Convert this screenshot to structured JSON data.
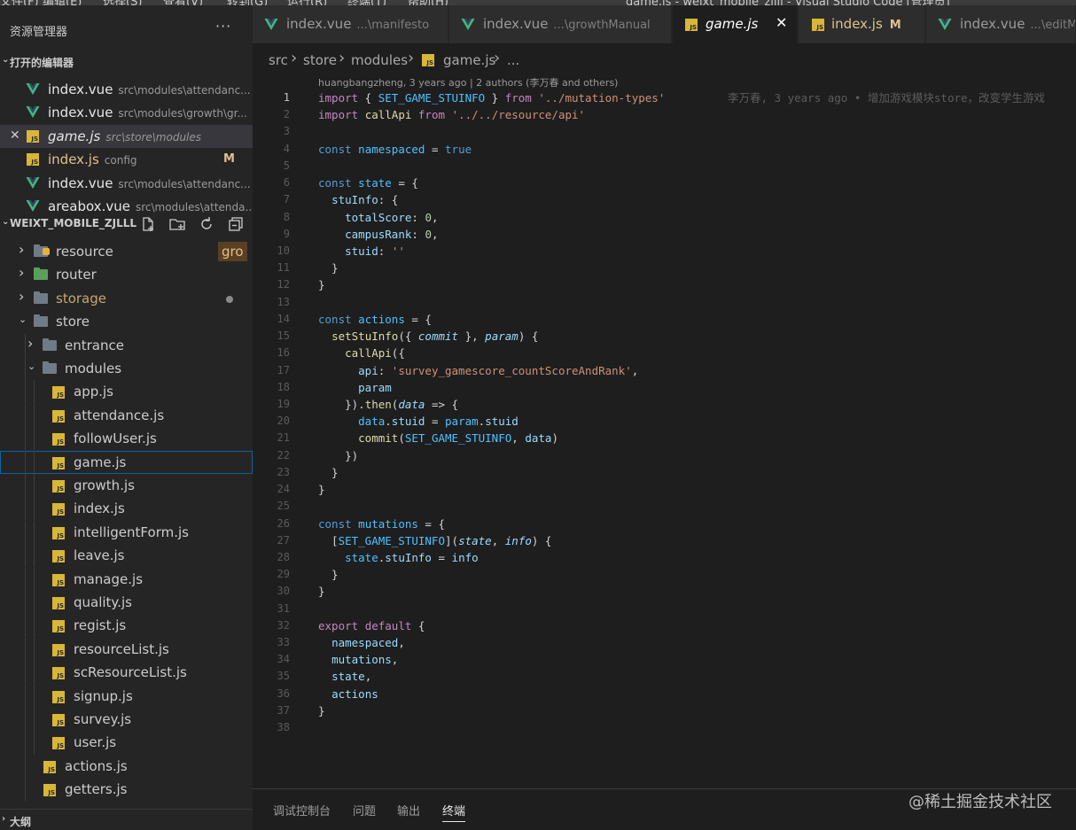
{
  "menubar": {
    "items": [
      "文件(F)",
      "编辑(E)",
      "选择(S)",
      "查看(V)",
      "转到(G)",
      "运行(R)",
      "终端(T)",
      "帮助(H)"
    ],
    "window_title": "game.js - weixt_mobile_zjlll - Visual Studio Code [管理员]"
  },
  "sidebar": {
    "title": "资源管理器",
    "more_label": "···",
    "open_editors_label": "打开的编辑器",
    "open_editors": [
      {
        "name": "index.vue",
        "path": "src\\modules\\attendanc...",
        "icon": "vue-icon"
      },
      {
        "name": "index.vue",
        "path": "src\\modules\\growth\\gr...",
        "icon": "vue-icon"
      },
      {
        "name": "game.js",
        "path": "src\\store\\modules",
        "icon": "js-icon",
        "active": true,
        "close": "✕"
      },
      {
        "name": "index.js",
        "path": "config",
        "icon": "js-icon",
        "badge": "M"
      },
      {
        "name": "index.vue",
        "path": "src\\modules\\attendanc...",
        "icon": "vue-icon"
      },
      {
        "name": "areabox.vue",
        "path": "src\\modules\\attenda...",
        "icon": "vue-icon"
      }
    ],
    "project_label": "WEIXT_MOBILE_ZJLLL",
    "project_actions": [
      "new-file-icon",
      "new-folder-icon",
      "refresh-icon",
      "collapse-icon"
    ],
    "tree": [
      {
        "name": "resource",
        "kind": "folder",
        "depth": 1,
        "tag": "gro"
      },
      {
        "name": "router",
        "kind": "folder",
        "depth": 1
      },
      {
        "name": "storage",
        "kind": "folder",
        "depth": 1,
        "dot": true
      },
      {
        "name": "store",
        "kind": "folder",
        "depth": 1,
        "open": true
      },
      {
        "name": "entrance",
        "kind": "folder",
        "depth": 2
      },
      {
        "name": "modules",
        "kind": "folder",
        "depth": 2,
        "open": true
      },
      {
        "name": "app.js",
        "kind": "file",
        "depth": 3
      },
      {
        "name": "attendance.js",
        "kind": "file",
        "depth": 3
      },
      {
        "name": "followUser.js",
        "kind": "file",
        "depth": 3
      },
      {
        "name": "game.js",
        "kind": "file",
        "depth": 3,
        "selected": true
      },
      {
        "name": "growth.js",
        "kind": "file",
        "depth": 3
      },
      {
        "name": "index.js",
        "kind": "file",
        "depth": 3
      },
      {
        "name": "intelligentForm.js",
        "kind": "file",
        "depth": 3
      },
      {
        "name": "leave.js",
        "kind": "file",
        "depth": 3
      },
      {
        "name": "manage.js",
        "kind": "file",
        "depth": 3
      },
      {
        "name": "quality.js",
        "kind": "file",
        "depth": 3
      },
      {
        "name": "regist.js",
        "kind": "file",
        "depth": 3
      },
      {
        "name": "resourceList.js",
        "kind": "file",
        "depth": 3
      },
      {
        "name": "scResourceList.js",
        "kind": "file",
        "depth": 3
      },
      {
        "name": "signup.js",
        "kind": "file",
        "depth": 3
      },
      {
        "name": "survey.js",
        "kind": "file",
        "depth": 3
      },
      {
        "name": "user.js",
        "kind": "file",
        "depth": 3
      },
      {
        "name": "actions.js",
        "kind": "file",
        "depth": 2
      },
      {
        "name": "getters.js",
        "kind": "file",
        "depth": 2
      }
    ],
    "outline_label": "大纲"
  },
  "tabs": [
    {
      "name": "index.vue",
      "desc": "...\\manifesto",
      "icon": "vue-icon"
    },
    {
      "name": "index.vue",
      "desc": "...\\growthManual",
      "icon": "vue-icon"
    },
    {
      "name": "game.js",
      "icon": "js-icon",
      "active": true,
      "close": "✕"
    },
    {
      "name": "index.js",
      "icon": "js-icon",
      "badge": "M"
    },
    {
      "name": "index.vue",
      "desc": "...\\editMa",
      "icon": "vue-icon"
    }
  ],
  "breadcrumb": [
    "src",
    "store",
    "modules",
    "game.js",
    "..."
  ],
  "editor": {
    "codelens": "huangbangzheng, 3 years ago | 2 authors (李万春 and others)",
    "blame": "李万春, 3 years ago • 增加游戏模块store，改变学生游戏",
    "current_line": 1,
    "lines": [
      "import { SET_GAME_STUINFO } from '../mutation-types'",
      "import callApi from '../../resource/api'",
      "",
      "const namespaced = true",
      "",
      "const state = {",
      "  stuInfo: {",
      "    totalScore: 0,",
      "    campusRank: 0,",
      "    stuid: ''",
      "  }",
      "}",
      "",
      "const actions = {",
      "  setStuInfo({ commit }, param) {",
      "    callApi({",
      "      api: 'survey_gamescore_countScoreAndRank',",
      "      param",
      "    }).then(data => {",
      "      data.stuid = param.stuid",
      "      commit(SET_GAME_STUINFO, data)",
      "    })",
      "  }",
      "}",
      "",
      "const mutations = {",
      "  [SET_GAME_STUINFO](state, info) {",
      "    state.stuInfo = info",
      "  }",
      "}",
      "",
      "export default {",
      "  namespaced,",
      "  mutations,",
      "  state,",
      "  actions",
      "}",
      ""
    ]
  },
  "panel": {
    "tabs": [
      "调试控制台",
      "问题",
      "输出",
      "终端"
    ],
    "active": "终端",
    "watermark": "@稀土掘金技术社区"
  },
  "colors": {
    "accent": "#0e639c",
    "modified": "#e2c08d",
    "js": "#d8b638",
    "vue": "#41b883"
  }
}
